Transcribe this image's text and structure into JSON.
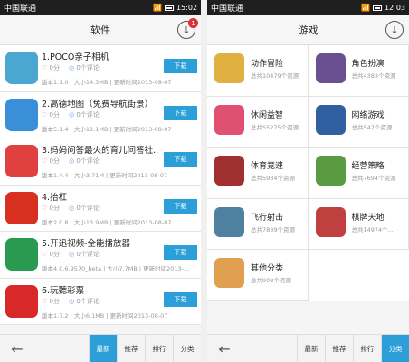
{
  "left": {
    "status": {
      "carrier": "中国联通",
      "time": "15:02"
    },
    "title": "软件",
    "badge": "1",
    "apps": [
      {
        "name": "1.POCO亲子相机",
        "likes": "0分",
        "comments": "0个评论",
        "info": "版本1.1.0 | 大小14.3MB | 更新时间2013-08-07",
        "button": "下载",
        "color": "#4aa8d0"
      },
      {
        "name": "2.高德地图（免费导航街景）",
        "likes": "0分",
        "comments": "0个评论",
        "info": "版本5.1.4 | 大小12.1MB | 更新时间2013-08-07",
        "button": "下载",
        "color": "#3a8fd8"
      },
      {
        "name": "3.妈妈问答最火的育儿问答社...",
        "likes": "0分",
        "comments": "0个评论",
        "info": "版本1.4.4 | 大小3.71M | 更新时间2013-08-07",
        "button": "下载",
        "color": "#e04040"
      },
      {
        "name": "4.抬杠",
        "likes": "0分",
        "comments": "0个评论",
        "info": "版本2.0.8 | 大小13.9MB | 更新时间2013-08-07",
        "button": "下载",
        "color": "#d83020"
      },
      {
        "name": "5.开迅视频-全能播放器",
        "likes": "0分",
        "comments": "0个评论",
        "info": "版本4.0.6.9570_beta | 大小7.7MB | 更新时间2013-...",
        "button": "下载",
        "color": "#2a9a50"
      },
      {
        "name": "6.玩聽彩票",
        "likes": "0分",
        "comments": "0个评论",
        "info": "版本1.7.2 | 大小6.1MB | 更新时间2013-08-07",
        "button": "下载",
        "color": "#d82828"
      }
    ],
    "bottom": {
      "back": "←",
      "tabs": [
        "最新",
        "推荐",
        "排行",
        "分类"
      ],
      "active": 0
    }
  },
  "right": {
    "status": {
      "carrier": "中国联通",
      "time": "12:03"
    },
    "title": "游戏",
    "categories": [
      {
        "name": "动作冒险",
        "count": "总共10479个资源",
        "color": "#e0b040"
      },
      {
        "name": "角色扮演",
        "count": "总共4383个资源",
        "color": "#6a5090"
      },
      {
        "name": "休闲益智",
        "count": "总共55275个资源",
        "color": "#e05070"
      },
      {
        "name": "网络游戏",
        "count": "总共547个资源",
        "color": "#3060a0"
      },
      {
        "name": "体育竞速",
        "count": "总共5934个资源",
        "color": "#a03030"
      },
      {
        "name": "经营策略",
        "count": "总共7694个资源",
        "color": "#5a9a40"
      },
      {
        "name": "飞行射击",
        "count": "总共7839个资源",
        "color": "#5080a0"
      },
      {
        "name": "棋牌天地",
        "count": "总共14974个...",
        "color": "#c04040"
      },
      {
        "name": "其他分类",
        "count": "总共908个资源",
        "color": "#e0a050"
      }
    ],
    "bottom": {
      "back": "←",
      "tabs": [
        "最新",
        "推荐",
        "排行",
        "分类"
      ],
      "active": 3
    }
  }
}
